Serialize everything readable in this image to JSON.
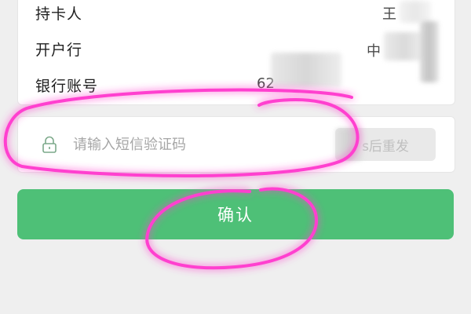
{
  "card_info": {
    "holder_label": "持卡人",
    "holder_value": "王",
    "bank_label": "开户行",
    "bank_value": "中",
    "account_label": "银行账号",
    "account_value": "62"
  },
  "sms": {
    "placeholder": "请输入短信验证码",
    "resend_label": "s后重发"
  },
  "confirm_label": "确认",
  "colors": {
    "primary": "#4ec077",
    "annotation": "#ff3fcf"
  }
}
